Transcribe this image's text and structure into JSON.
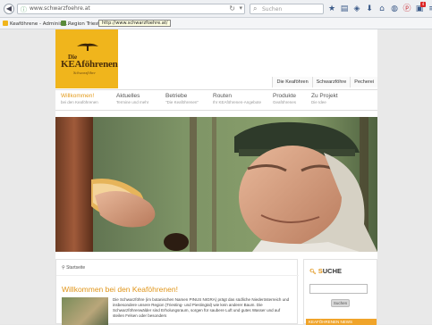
{
  "browser": {
    "url": "www.schwarzfoehre.at",
    "search_placeholder": "Suchen",
    "bookmarks": [
      {
        "label": "Keaföhrene - Administ..."
      },
      {
        "label": "Region Triesting"
      }
    ],
    "tooltip": "http://www.schwarzfoehre.at/"
  },
  "site": {
    "logo": {
      "die": "Die",
      "name": "KEAföhrenen",
      "sub": "Schwarzföhre"
    },
    "toplinks": [
      "Die Keaföhren",
      "Schwarzföhre",
      "Pecherei"
    ],
    "nav": [
      {
        "title": "Willkommen!",
        "sub": "bei den Keaföhrenen"
      },
      {
        "title": "Aktuelles",
        "sub": "Termine und mehr"
      },
      {
        "title": "Betriebe",
        "sub": "\"Die Keaföhrenen\""
      },
      {
        "title": "Routen",
        "sub": "Ihr KEAföhrenen-Angebote"
      },
      {
        "title": "Produkte",
        "sub": "Geaföhrenes"
      },
      {
        "title": "Zu Projekt",
        "sub": "Die Idee"
      }
    ],
    "breadcrumb": "Startseite",
    "welcome_heading": "Willkommen bei den Keaföhrenen!",
    "intro_text": "Die Schwarzföhre (im botanischen Namen PINUS NIGRA) prägt das südliche Niederösterreich und insbesondere unsere Region (Triesting- und Piestingtal) wie kein anderer Baum. Die Schwarzföhrenwälder sind Erholungsraum, sorgen für saubere Luft und gutes Wasser und auf steilen Felsen oder besonders",
    "sidebar": {
      "title_first": "S",
      "title_rest": "UCHE",
      "button": "Suchen",
      "orange_label": "KEAFÖHRENEN NEWS"
    }
  },
  "colors": {
    "accent": "#e0951a",
    "logo_bg": "#f0b51c"
  }
}
